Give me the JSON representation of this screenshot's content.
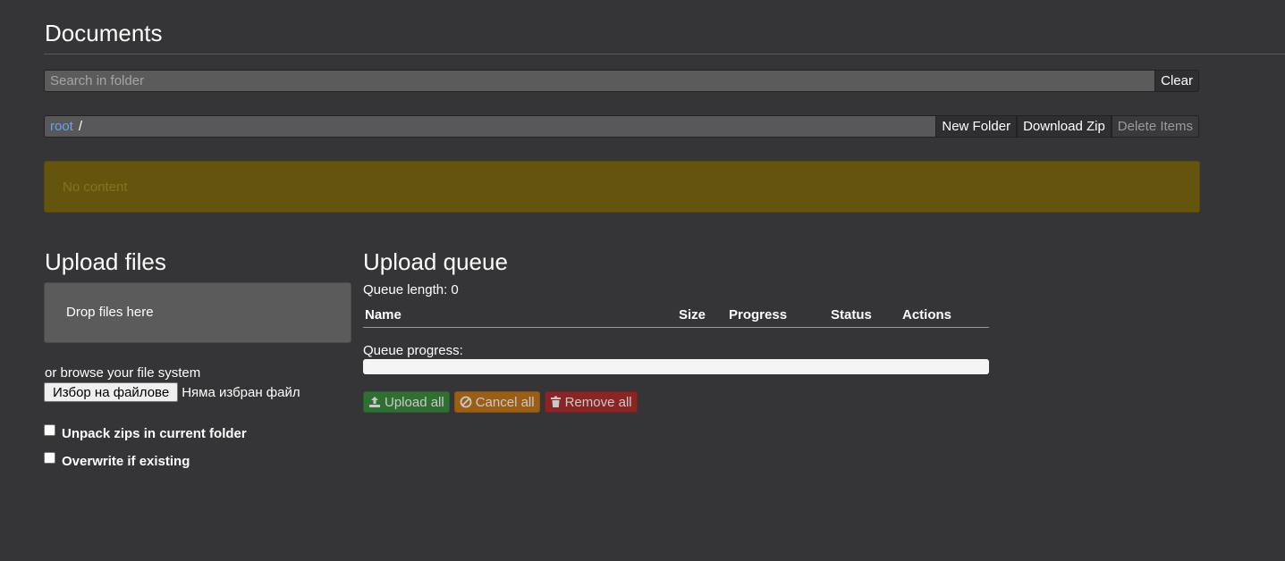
{
  "header": {
    "title": "Documents"
  },
  "search": {
    "placeholder": "Search in folder",
    "value": "",
    "clear_label": "Clear"
  },
  "breadcrumb": {
    "root_label": "root",
    "separator": "/"
  },
  "toolbar": {
    "new_folder_label": "New Folder",
    "download_zip_label": "Download Zip",
    "delete_items_label": "Delete Items"
  },
  "content": {
    "empty_message": "No content"
  },
  "upload": {
    "title": "Upload files",
    "drop_text": "Drop files here",
    "browse_text": "or browse your file system",
    "file_button_label": "Избор на файлове",
    "file_status": "Няма избран файл",
    "unpack_label": "Unpack zips in current folder",
    "overwrite_label": "Overwrite if existing"
  },
  "queue": {
    "title": "Upload queue",
    "length_text": "Queue length: 0",
    "columns": [
      "Name",
      "Size",
      "Progress",
      "Status",
      "Actions"
    ],
    "progress_label": "Queue progress:",
    "progress_value": 0,
    "upload_all_label": "Upload all",
    "cancel_all_label": "Cancel all",
    "remove_all_label": "Remove all"
  },
  "colors": {
    "background": "#353537",
    "link": "#6aa0ec",
    "warning_panel": "#65540e",
    "success": "#2f6f31",
    "warning": "#9a5f15",
    "danger": "#8a2525"
  },
  "icons": {
    "upload": "upload-icon",
    "cancel": "ban-icon",
    "remove": "trash-icon"
  }
}
